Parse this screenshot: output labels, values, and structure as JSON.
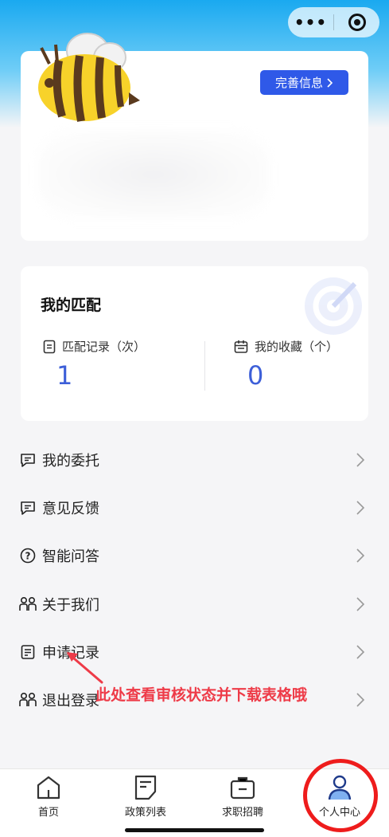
{
  "capsule": {
    "more_icon": "more-dots-icon",
    "close_icon": "record-icon"
  },
  "profile": {
    "complete_button": "完善信息"
  },
  "match": {
    "title": "我的匹配",
    "records_label": "匹配记录（次）",
    "records_value": "1",
    "favorites_label": "我的收藏（个）",
    "favorites_value": "0"
  },
  "menu": [
    {
      "label": "我的委托",
      "icon": "message-icon"
    },
    {
      "label": "意见反馈",
      "icon": "message-icon"
    },
    {
      "label": "智能问答",
      "icon": "question-icon"
    },
    {
      "label": "关于我们",
      "icon": "people-icon"
    },
    {
      "label": "申请记录",
      "icon": "record-icon"
    },
    {
      "label": "退出登录",
      "icon": "people-icon"
    }
  ],
  "annotation": "此处查看审核状态并下载表格哦",
  "tabbar": [
    {
      "label": "首页",
      "icon": "home-icon"
    },
    {
      "label": "政策列表",
      "icon": "document-icon"
    },
    {
      "label": "求职招聘",
      "icon": "briefcase-icon"
    },
    {
      "label": "个人中心",
      "icon": "user-icon"
    }
  ],
  "colors": {
    "accent": "#2f59e8",
    "value": "#3d5fd8",
    "annotation": "#ee3b48",
    "header": "#1aa9f0"
  }
}
